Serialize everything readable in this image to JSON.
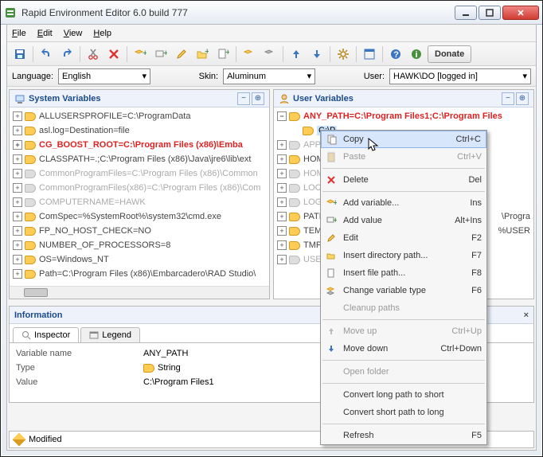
{
  "window": {
    "title": "Rapid Environment Editor 6.0 build 777"
  },
  "menu": {
    "file": "File",
    "edit": "Edit",
    "view": "View",
    "help": "Help"
  },
  "donate": "Donate",
  "opt": {
    "language_lbl": "Language:",
    "language_val": "English",
    "skin_lbl": "Skin:",
    "skin_val": "Aluminum",
    "user_lbl": "User:",
    "user_val": "HAWK\\DO [logged in]"
  },
  "panels": {
    "sys": "System Variables",
    "usr": "User Variables"
  },
  "sys_rows": [
    {
      "t": "ALLUSERSPROFILE=C:\\ProgramData",
      "c": ""
    },
    {
      "t": "asl.log=Destination=file",
      "c": ""
    },
    {
      "t": "CG_BOOST_ROOT=C:\\Program Files (x86)\\Emba",
      "c": "red"
    },
    {
      "t": "CLASSPATH=.;C:\\Program Files (x86)\\Java\\jre6\\lib\\ext",
      "c": ""
    },
    {
      "t": "CommonProgramFiles=C:\\Program Files (x86)\\Common",
      "c": "gray"
    },
    {
      "t": "CommonProgramFiles(x86)=C:\\Program Files (x86)\\Com",
      "c": "gray"
    },
    {
      "t": "COMPUTERNAME=HAWK",
      "c": "gray"
    },
    {
      "t": "ComSpec=%SystemRoot%\\system32\\cmd.exe",
      "c": ""
    },
    {
      "t": "FP_NO_HOST_CHECK=NO",
      "c": ""
    },
    {
      "t": "NUMBER_OF_PROCESSORS=8",
      "c": ""
    },
    {
      "t": "OS=Windows_NT",
      "c": ""
    },
    {
      "t": "Path=C:\\Program Files (x86)\\Embarcadero\\RAD Studio\\",
      "c": ""
    }
  ],
  "usr_parent": "ANY_PATH=C:\\Program Files1;C:\\Program Files",
  "usr_selected": "C:\\P",
  "usr_rows": [
    {
      "t": "APPD",
      "c": "gray"
    },
    {
      "t": "HOME",
      "c": ""
    },
    {
      "t": "HOME",
      "c": "gray"
    },
    {
      "t": "LOCA",
      "c": "gray"
    },
    {
      "t": "LOGO",
      "c": "gray"
    },
    {
      "t": "PATH",
      "tail": "\\Progra",
      "c": ""
    },
    {
      "t": "TEMP",
      "tail": "%USER",
      "c": ""
    },
    {
      "t": "TMP",
      "c": ""
    },
    {
      "t": "USER",
      "c": "gray"
    }
  ],
  "ctx": {
    "copy": "Copy",
    "copy_sc": "Ctrl+C",
    "paste": "Paste",
    "paste_sc": "Ctrl+V",
    "delete": "Delete",
    "delete_sc": "Del",
    "addvar": "Add variable...",
    "addvar_sc": "Ins",
    "addval": "Add value",
    "addval_sc": "Alt+Ins",
    "edit": "Edit",
    "edit_sc": "F2",
    "insdir": "Insert directory path...",
    "insdir_sc": "F7",
    "insfile": "Insert file path...",
    "insfile_sc": "F8",
    "chtype": "Change variable type",
    "chtype_sc": "F6",
    "cleanup": "Cleanup paths",
    "moveup": "Move up",
    "moveup_sc": "Ctrl+Up",
    "movedn": "Move down",
    "movedn_sc": "Ctrl+Down",
    "openfolder": "Open folder",
    "conv_ls": "Convert long path to short",
    "conv_sl": "Convert short path to long",
    "refresh": "Refresh",
    "refresh_sc": "F5"
  },
  "info": {
    "title": "Information",
    "tab_inspector": "Inspector",
    "tab_legend": "Legend",
    "k_varname": "Variable name",
    "v_varname": "ANY_PATH",
    "k_type": "Type",
    "v_type": "String",
    "k_value": "Value",
    "v_value": "C:\\Program Files1"
  },
  "status": "Modified"
}
